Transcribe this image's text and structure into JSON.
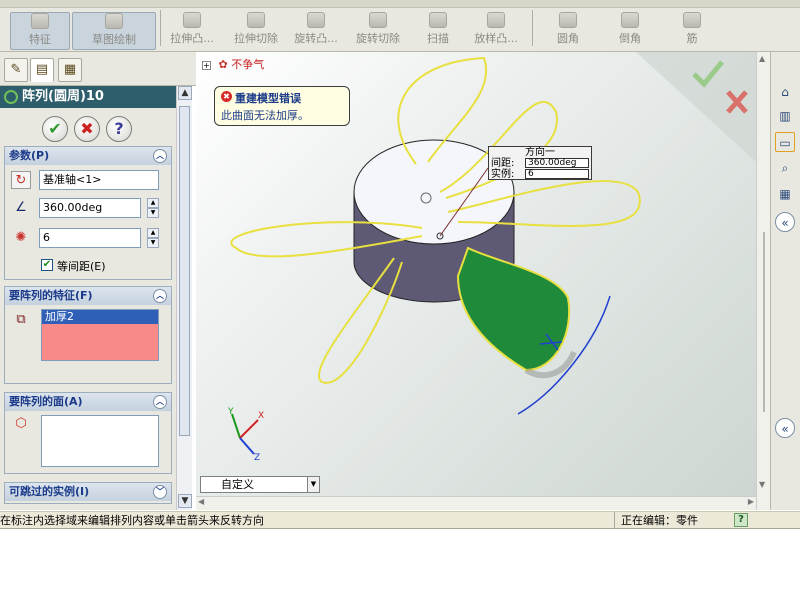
{
  "toolbar": {
    "buttons": [
      {
        "label": "特征",
        "icon": "feature-icon"
      },
      {
        "label": "草图绘制",
        "icon": "sketch-icon"
      },
      {
        "label": "拉伸凸...",
        "icon": "extrude-boss-icon"
      },
      {
        "label": "拉伸切除",
        "icon": "extrude-cut-icon"
      },
      {
        "label": "旋转凸...",
        "icon": "revolve-boss-icon"
      },
      {
        "label": "旋转切除",
        "icon": "revolve-cut-icon"
      },
      {
        "label": "扫描",
        "icon": "sweep-icon"
      },
      {
        "label": "放样凸...",
        "icon": "loft-icon"
      },
      {
        "label": "圆角",
        "icon": "fillet-icon"
      },
      {
        "label": "倒角",
        "icon": "chamfer-icon"
      },
      {
        "label": "筋",
        "icon": "rib-icon"
      }
    ]
  },
  "left_tabs": [
    "feature-manager-tab",
    "property-manager-tab",
    "configuration-manager-tab"
  ],
  "property_manager": {
    "title": "阵列(圆周)10",
    "ok_symbol": "✔",
    "cancel_symbol": "✖",
    "help_symbol": "?",
    "params": {
      "title": "参数(P)",
      "axis_value": "基准轴<1>",
      "angle_value": "360.00deg",
      "instances_value": "6",
      "equal_spacing_label": "等间距(E)",
      "equal_spacing_checked": true
    },
    "features_to_pattern": {
      "title": "要阵列的特征(F)",
      "items": [
        "加厚2"
      ]
    },
    "faces_to_pattern": {
      "title": "要阵列的面(A)"
    },
    "instances_to_skip": {
      "title": "可跳过的实例(I)"
    }
  },
  "error_callout": {
    "title": "重建模型错误",
    "message": "此曲面无法加厚。"
  },
  "viewport": {
    "tree_root_label": "不争气",
    "dim_callout": {
      "title": "方向一",
      "spacing_label": "间距:",
      "spacing_value": "360.00deg",
      "instances_label": "实例:",
      "instances_value": "6"
    },
    "config_select_value": "自定义",
    "colors": {
      "sketch_curve": "#e8e040",
      "thicken_face": "#1f8a3a",
      "cylinder_side": "#5e5a75",
      "accept_check": "#9acb8a",
      "reject_x": "#d9706a"
    }
  },
  "status": {
    "hint": "在标注内选择域来编辑排列内容或单击箭头来反转方向",
    "editing": "正在编辑：零件",
    "help_symbol": "?"
  }
}
